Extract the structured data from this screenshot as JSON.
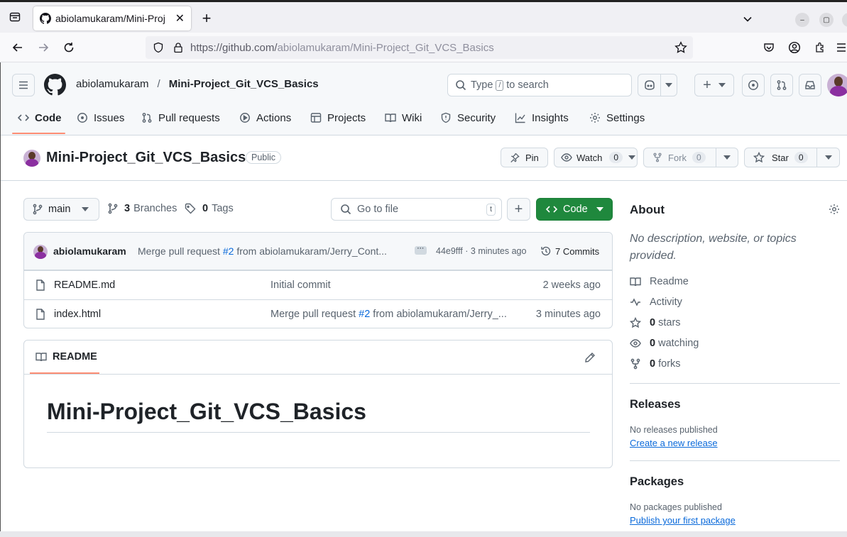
{
  "browser": {
    "tab_title": "abiolamukaram/Mini-Proj",
    "url_prefix": "https://github.com/",
    "url_path": "abiolamukaram/Mini-Project_Git_VCS_Basics"
  },
  "header": {
    "owner": "abiolamukaram",
    "separator": "/",
    "repo": "Mini-Project_Git_VCS_Basics",
    "search_placeholder_pre": "Type",
    "search_key": "/",
    "search_placeholder_post": "to search"
  },
  "tabs": [
    {
      "label": "Code",
      "icon": "code-icon",
      "active": true
    },
    {
      "label": "Issues",
      "icon": "issue-icon"
    },
    {
      "label": "Pull requests",
      "icon": "pull-request-icon"
    },
    {
      "label": "Actions",
      "icon": "play-icon"
    },
    {
      "label": "Projects",
      "icon": "table-icon"
    },
    {
      "label": "Wiki",
      "icon": "book-icon"
    },
    {
      "label": "Security",
      "icon": "shield-icon"
    },
    {
      "label": "Insights",
      "icon": "graph-icon"
    },
    {
      "label": "Settings",
      "icon": "gear-icon"
    }
  ],
  "repo": {
    "name": "Mini-Project_Git_VCS_Basics",
    "visibility": "Public",
    "pin": "Pin",
    "watch": "Watch",
    "watch_count": "0",
    "fork": "Fork",
    "fork_count": "0",
    "star": "Star",
    "star_count": "0"
  },
  "toolbar": {
    "branch": "main",
    "branches_count": "3",
    "branches_label": "Branches",
    "tags_count": "0",
    "tags_label": "Tags",
    "goto_placeholder": "Go to file",
    "goto_key": "t",
    "code_button": "Code"
  },
  "commit": {
    "author": "abiolamukaram",
    "msg_pre": "Merge pull request",
    "pr": "#2",
    "msg_post": "from abiolamukaram/Jerry_Cont...",
    "sha": "44e9fff",
    "dot": "·",
    "time": "3 minutes ago",
    "commits": "7 Commits"
  },
  "files": [
    {
      "name": "README.md",
      "msg_pre": "Initial commit",
      "pr": "",
      "msg_post": "",
      "time": "2 weeks ago"
    },
    {
      "name": "index.html",
      "msg_pre": "Merge pull request",
      "pr": "#2",
      "msg_post": "from abiolamukaram/Jerry_...",
      "time": "3 minutes ago"
    }
  ],
  "readme": {
    "tab": "README",
    "heading": "Mini-Project_Git_VCS_Basics"
  },
  "sidebar": {
    "about_title": "About",
    "about_text": "No description, website, or topics provided.",
    "readme": "Readme",
    "activity": "Activity",
    "stars_count": "0",
    "stars": "stars",
    "watching_count": "0",
    "watching": "watching",
    "forks_count": "0",
    "forks": "forks",
    "releases_title": "Releases",
    "releases_text": "No releases published",
    "releases_link": "Create a new release",
    "packages_title": "Packages",
    "packages_text": "No packages published",
    "packages_link": "Publish your first package"
  },
  "colors": {
    "accent": "#fd8c73",
    "green": "#1f883d",
    "link": "#0969da"
  }
}
